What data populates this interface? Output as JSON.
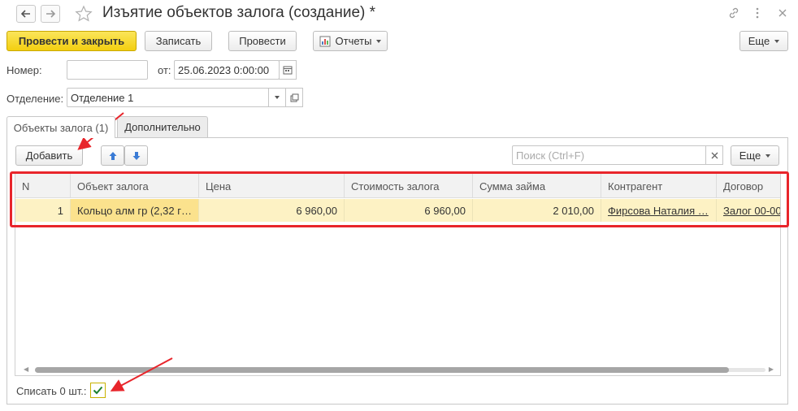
{
  "window": {
    "title": "Изъятие объектов залога (создание) *",
    "back_icon": "arrow-left-icon",
    "forward_icon": "arrow-right-icon",
    "favorite_icon": "star-icon",
    "link_icon": "link-icon",
    "menu_icon": "more-vertical-icon",
    "close_icon": "close-icon"
  },
  "toolbar": {
    "post_close_label": "Провести и закрыть",
    "save_label": "Записать",
    "post_label": "Провести",
    "reports_label": "Отчеты",
    "more_label": "Еще"
  },
  "form": {
    "number_label": "Номер:",
    "number_value": "",
    "date_label": "от:",
    "date_value": "25.06.2023  0:00:00",
    "department_label": "Отделение:",
    "department_value": "Отделение 1"
  },
  "tabs": [
    {
      "label": "Объекты залога (1)"
    },
    {
      "label": "Дополнительно"
    }
  ],
  "table_toolbar": {
    "add_label": "Добавить",
    "search_placeholder": "Поиск (Ctrl+F)",
    "more_label": "Еще"
  },
  "table": {
    "columns": [
      "N",
      "Объект залога",
      "Цена",
      "Стоимость залога",
      "Сумма займа",
      "Контрагент",
      "Договор"
    ],
    "rows": [
      {
        "n": "1",
        "object": "Кольцо алм гр (2,32 г…",
        "price": "6 960,00",
        "pledge_value": "6 960,00",
        "loan_sum": "2 010,00",
        "counterparty": "Фирсова Наталия …",
        "contract": "Залог 00-00"
      }
    ]
  },
  "footer": {
    "write_off_label": "Списать 0 шт.:",
    "write_off_checked": true
  },
  "colors": {
    "primary_button": "#f5d41f",
    "selected_row": "#fdf2c4",
    "highlight": "#e8252b"
  }
}
